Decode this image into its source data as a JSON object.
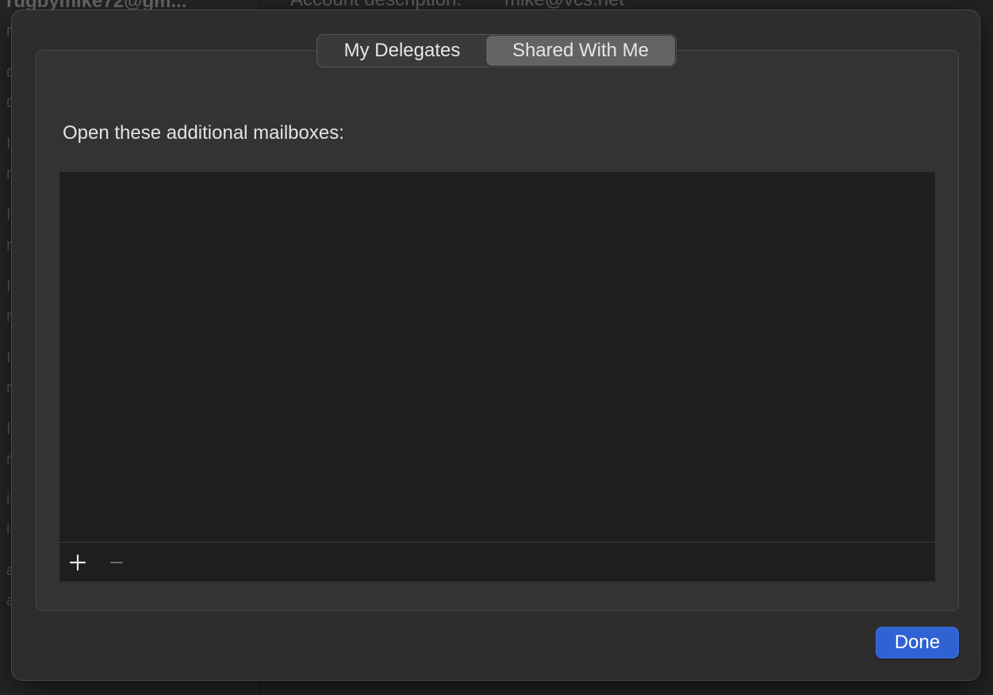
{
  "background": {
    "sidebar_title": "rugbymike72@gm...",
    "sidebar_fragments": [
      "r",
      "c",
      "c",
      "I",
      "r",
      "I",
      "r",
      "I",
      "r",
      "I",
      "r",
      "I",
      "r",
      "i",
      "i",
      "a",
      "a"
    ],
    "main_label": "Account description:",
    "main_value": "mike@vcs.net"
  },
  "tabs": [
    {
      "label": "My Delegates",
      "selected": false
    },
    {
      "label": "Shared With Me",
      "selected": true
    }
  ],
  "section_label": "Open these additional mailboxes:",
  "mailboxes": [],
  "footer": {
    "add_icon": "plus-icon",
    "remove_icon": "minus-icon"
  },
  "done_label": "Done",
  "colors": {
    "accent": "#2f63d4",
    "sheet_bg": "#2d2d2d",
    "list_bg": "#1e1e1e"
  }
}
